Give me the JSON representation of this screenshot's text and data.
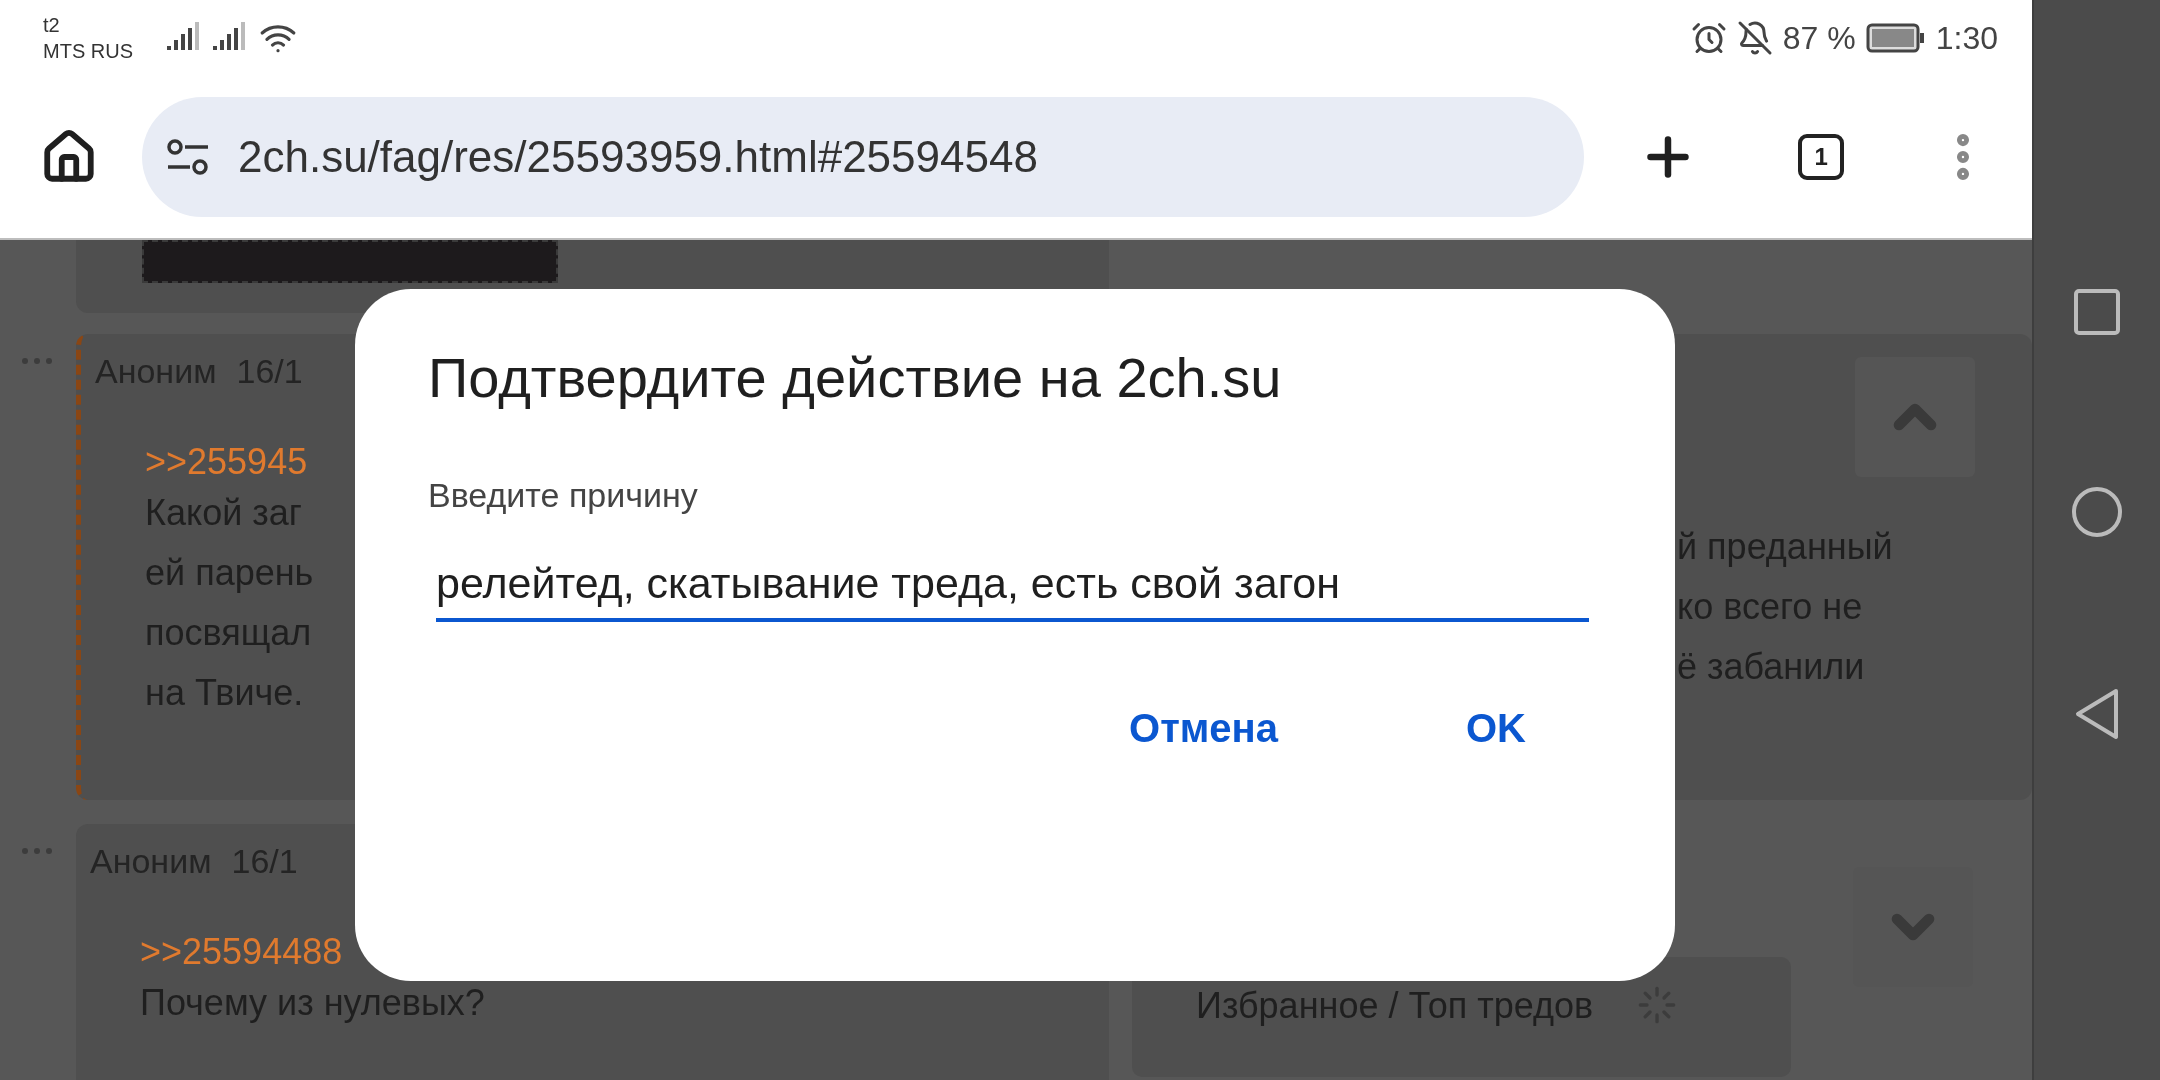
{
  "status_bar": {
    "carrier_top": "t2",
    "carrier": "MTS RUS",
    "battery": "87 %",
    "time": "1:30"
  },
  "browser": {
    "url": "2ch.su/fag/res/25593959.html#25594548",
    "tab_count": "1"
  },
  "posts": [
    {
      "author": "Аноним",
      "date": "16/1",
      "highlighted": true,
      "reply_link": ">>255945",
      "lines_left": [
        "Какой заг",
        "ей парень",
        "посвящал",
        "на Твиче."
      ],
      "lines_right": [
        "й преданный",
        "ко всего не",
        "ё забанили"
      ]
    },
    {
      "author": "Аноним",
      "date": "16/1",
      "highlighted": false,
      "reply_link": ">>25594488",
      "lines_left": [
        "Почему из нулевых?"
      ]
    }
  ],
  "favorites": {
    "label": "Избранное / Топ тредов"
  },
  "dialog": {
    "title": "Подтвердите действие на 2ch.su",
    "label": "Введите причину",
    "value": "релейтед, скатывание треда, есть свой загон",
    "buttons": [
      "Отмена",
      "OK"
    ]
  }
}
